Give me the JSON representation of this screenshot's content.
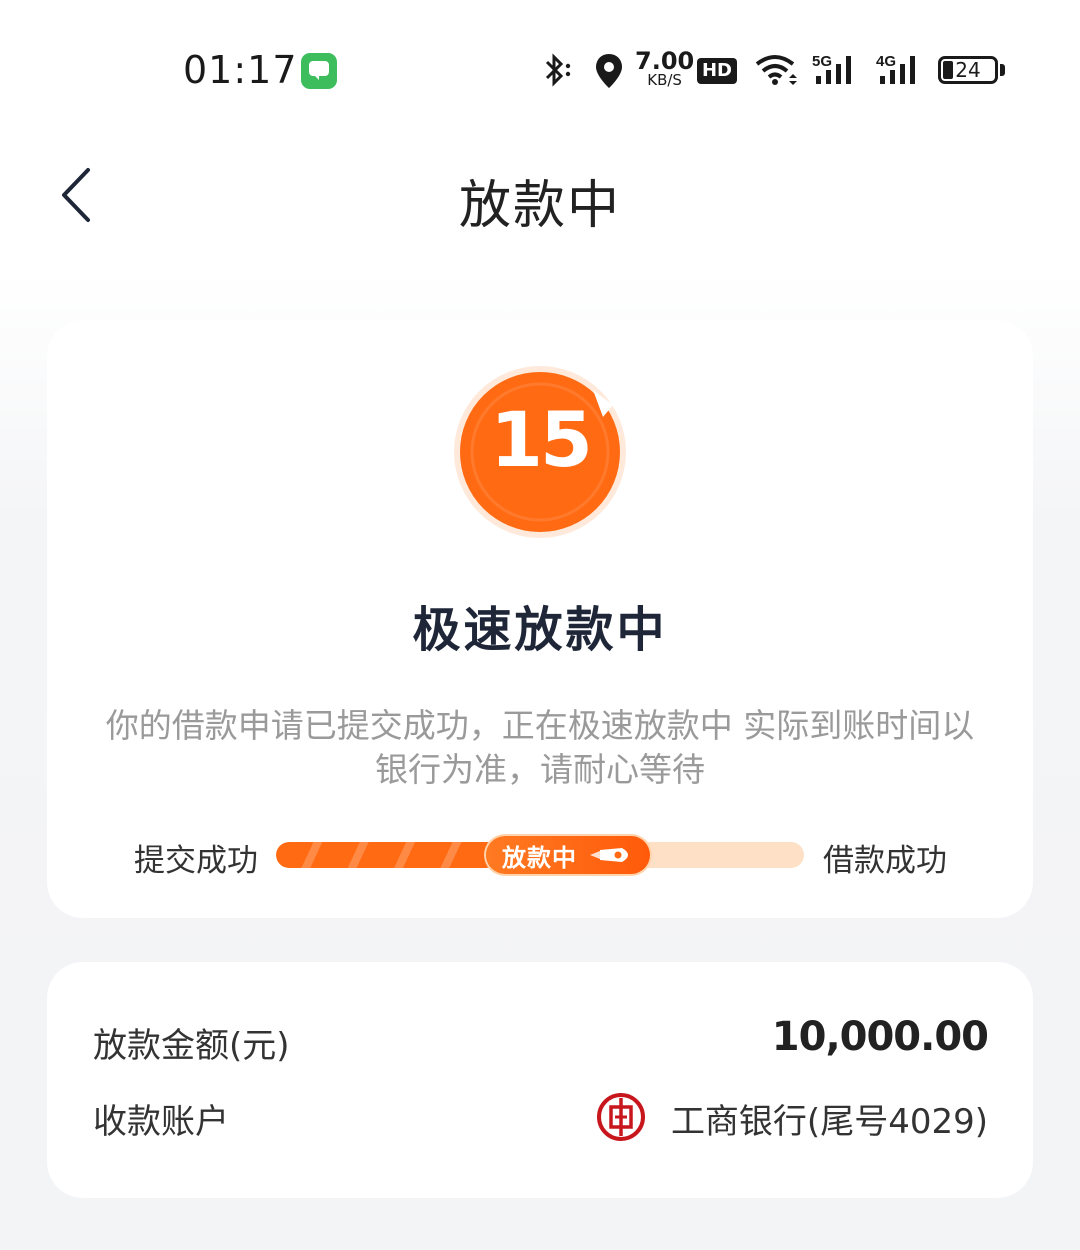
{
  "status_bar": {
    "time": "01:17",
    "network_speed_value": "7.00",
    "network_speed_unit": "KB/S",
    "hd_badge": "HD",
    "signal_5g": "5G",
    "signal_4g": "4G",
    "battery_level": "24",
    "icons": [
      "message-icon",
      "bluetooth-icon",
      "location-icon",
      "hd-icon",
      "wifi-icon",
      "signal-5g-icon",
      "signal-4g-icon",
      "battery-icon"
    ]
  },
  "header": {
    "title": "放款中",
    "back_icon": "chevron-left-icon"
  },
  "status_card": {
    "countdown": "15",
    "title": "极速放款中",
    "description": "你的借款申请已提交成功，正在极速放款中 实际到账时间以银行为准，请耐心等待",
    "progress": {
      "step_start": "提交成功",
      "step_current": "放款中",
      "step_end": "借款成功",
      "current_fraction": 0.5
    },
    "accent_color": "#ff6a12"
  },
  "details_card": {
    "amount_label": "放款金额(元)",
    "amount_value": "10,000.00",
    "account_label": "收款账户",
    "account_value": "工商银行(尾号4029)",
    "bank_logo_icon": "icbc-logo-icon"
  }
}
